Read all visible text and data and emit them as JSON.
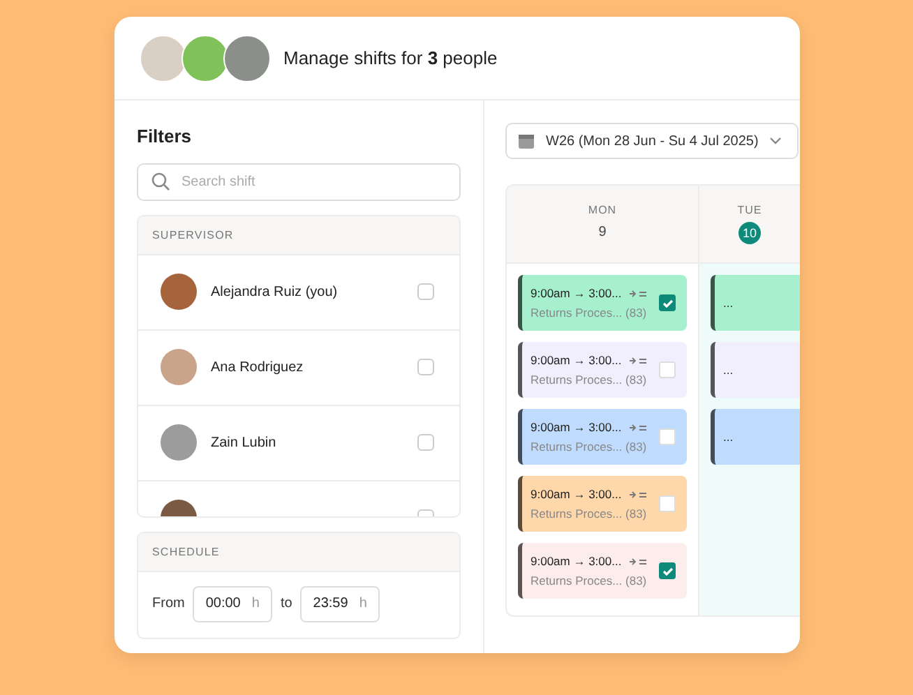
{
  "header": {
    "title": "Manage shifts for **3** people"
  },
  "filters": {
    "title": "Filters",
    "search": {
      "placeholder": "Search shift"
    },
    "supervisor": {
      "heading": "SUPERVISOR",
      "people": [
        {
          "name": "Alejandra Ruiz (you)",
          "checked": false
        },
        {
          "name": "Ana Rodriguez",
          "checked": false
        },
        {
          "name": "Zain Lubin",
          "checked": false
        },
        {
          "checked": false
        }
      ]
    },
    "schedule": {
      "heading": "SCHEDULE",
      "from_label": "From",
      "from": "00:00",
      "from_unit": "h",
      "to_label": "to",
      "to": "23:59",
      "to_unit": "h"
    }
  },
  "calendar": {
    "week": "W26 (Mon 28 Jun - Su 4 Jul 2025)",
    "days": [
      {
        "name": "MON",
        "date": "9",
        "selected": false,
        "shifts": [
          {
            "time": "9:00am → 3:00...",
            "task": "Returns Proces... (83)",
            "color": "#a7f0cd",
            "checked": true
          },
          {
            "time": "9:00am → 3:00...",
            "task": "Returns Proces... (83)",
            "color": "#f1effd",
            "checked": false
          },
          {
            "time": "9:00am → 3:00...",
            "task": "Returns Proces... (83)",
            "color": "#bfdbfe",
            "checked": false
          },
          {
            "time": "9:00am → 3:00...",
            "task": "Returns Proces... (83)",
            "color": "#fed7aa",
            "checked": false
          },
          {
            "time": "9:00am → 3:00...",
            "task": "Returns Proces... (83)",
            "color": "#fdecec",
            "checked": true
          }
        ]
      },
      {
        "name": "TUE",
        "date": "10",
        "selected": true,
        "shifts": [
          {
            "time": "...",
            "color": "#a7f0cd"
          },
          {
            "time": "...",
            "color": "#f1effd"
          },
          {
            "time": "...",
            "color": "#bfdbfe"
          }
        ]
      }
    ]
  }
}
